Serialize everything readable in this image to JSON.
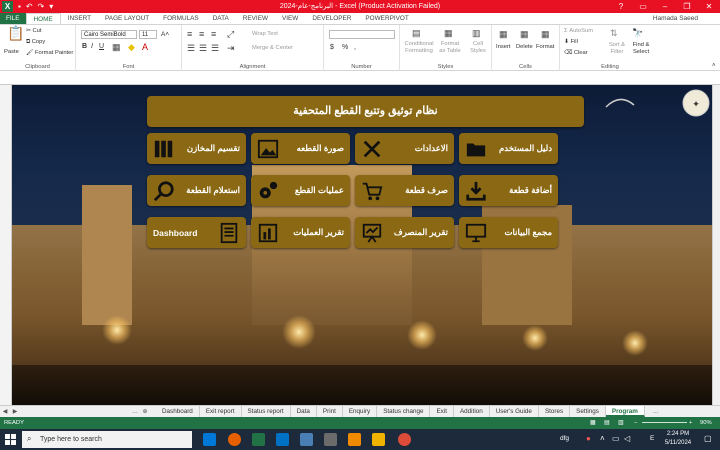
{
  "titlebar": {
    "title": "البرنامج-عام-2024 - Excel (Product Activation Failed)",
    "app_letter": "X",
    "controls": [
      "?",
      "▭",
      "–",
      "❐",
      "✕"
    ]
  },
  "ribbon_tabs": [
    "FILE",
    "HOME",
    "INSERT",
    "PAGE LAYOUT",
    "FORMULAS",
    "DATA",
    "REVIEW",
    "VIEW",
    "DEVELOPER",
    "POWERPIVOT"
  ],
  "user": "Hamada Saeed",
  "ribbon": {
    "clipboard": {
      "label": "Clipboard",
      "paste": "Paste",
      "cut": "Cut",
      "copy": "Copy",
      "format_painter": "Format Painter"
    },
    "font": {
      "label": "Font",
      "font_name": "Cairo SemiBold",
      "font_size": "11",
      "bold": "B",
      "italic": "I",
      "underline": "U"
    },
    "alignment": {
      "label": "Alignment",
      "wrap_text": "Wrap Text",
      "merge_center": "Merge & Center"
    },
    "number": {
      "label": "Number",
      "format": "",
      "currency": "$",
      "percent": "%",
      "comma": ","
    },
    "styles": {
      "label": "Styles",
      "conditional": "Conditional Formatting",
      "format_table": "Format as Table",
      "cell_styles": "Cell Styles"
    },
    "cells": {
      "label": "Cells",
      "insert": "Insert",
      "delete": "Delete",
      "format": "Format"
    },
    "editing": {
      "label": "Editing",
      "autosum": "AutoSum",
      "fill": "Fill",
      "clear": "Clear",
      "sort_filter": "Sort & Filter",
      "find_select": "Find & Select"
    }
  },
  "dashboard": {
    "header": "نظام توثيق وتتبع القطع المتحفية",
    "buttons": [
      {
        "label": "دليل المستخدم",
        "icon": "folder-icon"
      },
      {
        "label": "الاعدادات",
        "icon": "tools-icon"
      },
      {
        "label": "صورة القطعه",
        "icon": "image-icon"
      },
      {
        "label": "تقسيم المخازن",
        "icon": "books-icon"
      },
      {
        "label": "أضافة قطعة",
        "icon": "download-icon"
      },
      {
        "label": "صرف قطعة",
        "icon": "cart-icon"
      },
      {
        "label": "عمليات القطع",
        "icon": "gears-icon"
      },
      {
        "label": "استعلام  القطعة",
        "icon": "search-icon"
      },
      {
        "label": "مجمع البيانات",
        "icon": "computer-icon"
      },
      {
        "label": "تقرير المنصرف",
        "icon": "presentation-icon"
      },
      {
        "label": "تقرير العمليات",
        "icon": "bar-report-icon"
      },
      {
        "label": "Dashboard",
        "icon": "list-icon"
      }
    ]
  },
  "sheet_tabs": [
    "Dashboard",
    "Exit report",
    "Status report",
    "Data",
    "Print",
    "Enquiry",
    "Status change",
    "Exit",
    "Addition",
    "User's Guide",
    "Stores",
    "Settings",
    "Program"
  ],
  "active_sheet": "Program",
  "status": {
    "ready": "READY",
    "zoom": "90%"
  },
  "taskbar": {
    "search_placeholder": "Type here to search",
    "lang": "dfg",
    "kbd": "E",
    "time": "2:24 PM",
    "date": "5/11/2024"
  }
}
